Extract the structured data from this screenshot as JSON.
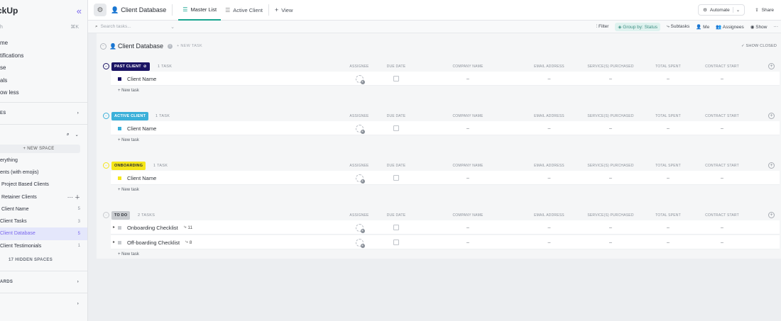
{
  "sidebar": {
    "logo": "ckUp",
    "collapse_icon": "double-chevron-left-icon",
    "search_placeholder": "h",
    "search_shortcut": "⌘K",
    "nav_items": [
      "me",
      "tifications",
      "se",
      "als",
      "ow less"
    ],
    "section_spaces": "ES",
    "new_space": "+ NEW SPACE",
    "spaces": [
      {
        "label": "erything",
        "count": ""
      },
      {
        "label": "ents (with emojis)",
        "count": ""
      },
      {
        "label": "Project Based Clients",
        "count": ""
      },
      {
        "label": "Retainer Clients",
        "count": ""
      },
      {
        "label": "Client Name",
        "count": "5"
      },
      {
        "label": "Client Tasks",
        "count": "3"
      },
      {
        "label": "Client Database",
        "count": "5"
      },
      {
        "label": "Client Testimonials",
        "count": "1"
      }
    ],
    "hidden_spaces": "17 HIDDEN SPACES",
    "section_dashboards": "ARDS"
  },
  "topbar": {
    "breadcrumb": "Client Database",
    "views": [
      "Master List",
      "Active Client",
      "View"
    ],
    "automate": "Automate",
    "share": "Share"
  },
  "toolbar": {
    "search_placeholder": "Search tasks...",
    "filter": "Filter",
    "group_by": "Group by: Status",
    "subtasks": "Subtasks",
    "me": "Me",
    "assignees": "Assignees",
    "show": "Show"
  },
  "list": {
    "title": "Client Database",
    "new_task": "+ NEW TASK",
    "show_closed": "SHOW CLOSED",
    "columns": [
      "ASSIGNEE",
      "DUE DATE",
      "COMPANY NAME",
      "EMAIL ADDRESS",
      "SERVICE(S) PURCHASED",
      "TOTAL SPENT",
      "CONTRACT START"
    ],
    "add_task": "+ New task",
    "dash": "–"
  },
  "groups": [
    {
      "status": "PAST CLIENT",
      "color": "#1b1464",
      "text_color": "#ffffff",
      "count": "1 TASK",
      "tasks": [
        {
          "name": "Client Name",
          "sub": ""
        }
      ]
    },
    {
      "status": "ACTIVE CLIENT",
      "color": "#3bb0d9",
      "text_color": "#ffffff",
      "count": "1 TASK",
      "tasks": [
        {
          "name": "Client Name",
          "sub": ""
        }
      ]
    },
    {
      "status": "ONBOARDING",
      "color": "#f5e61a",
      "text_color": "#2a2e34",
      "count": "1 TASK",
      "tasks": [
        {
          "name": "Client Name",
          "sub": ""
        }
      ]
    },
    {
      "status": "TO DO",
      "color": "#c8cbcf",
      "text_color": "#2a2e34",
      "count": "2 TASKS",
      "tasks": [
        {
          "name": "Onboarding Checklist",
          "sub": "11"
        },
        {
          "name": "Off-boarding Checklist",
          "sub": "8"
        }
      ]
    }
  ]
}
